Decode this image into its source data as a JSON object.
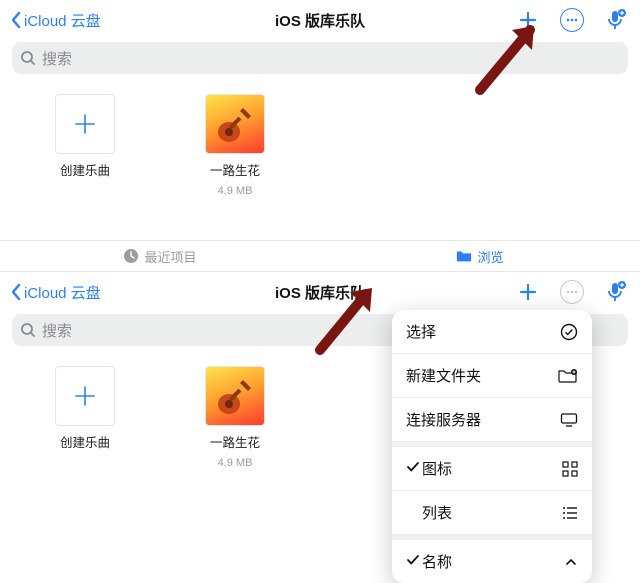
{
  "colors": {
    "accent": "#2a7ff6",
    "muted": "#9c9c9c"
  },
  "nav": {
    "back_label": "iCloud 云盘",
    "title": "iOS 版库乐队"
  },
  "search": {
    "placeholder": "搜索"
  },
  "tabs": {
    "recent": "最近项目",
    "browse": "浏览"
  },
  "files": {
    "create": {
      "name": "创建乐曲"
    },
    "song": {
      "name": "一路生花",
      "size": "4.9 MB"
    }
  },
  "menu": {
    "select": "选择",
    "new_folder": "新建文件夹",
    "connect_server": "连接服务器",
    "icons_view": "图标",
    "list_view": "列表",
    "name_sort": "名称"
  }
}
